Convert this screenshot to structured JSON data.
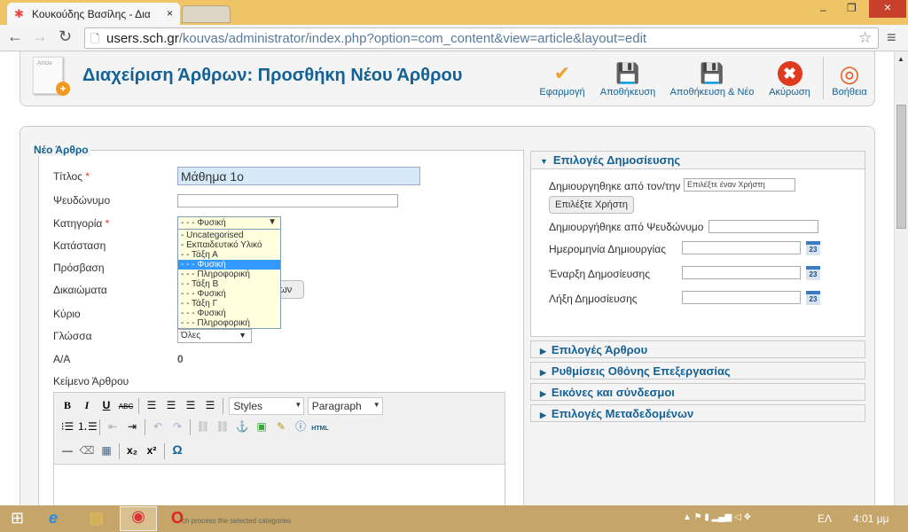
{
  "browser": {
    "tab_title": "Κουκούδης Βασίλης - Δια",
    "url_host": "users.sch.gr",
    "url_path": "/kouvas/administrator/index.php?option=com_content&view=article&layout=edit"
  },
  "header": {
    "title": "Διαχείριση Άρθρων: Προσθήκη Νέου Άρθρου",
    "icon_text": "Article",
    "buttons": [
      {
        "label": "Εφαρμογή",
        "icon": "check-icon",
        "color": "#f0a030"
      },
      {
        "label": "Αποθήκευση",
        "icon": "save-icon",
        "color": "#555"
      },
      {
        "label": "Αποθήκευση & Νέο",
        "icon": "save-new-icon",
        "color": "#555"
      },
      {
        "label": "Ακύρωση",
        "icon": "cancel-icon",
        "color": "#e03a1e"
      },
      {
        "label": "Βοήθεια",
        "icon": "lifebuoy-icon",
        "color": "#e85a20"
      }
    ]
  },
  "form": {
    "legend": "Νέο Άρθρο",
    "labels": {
      "title": "Τίτλος",
      "alias": "Ψευδώνυμο",
      "category": "Κατηγορία",
      "state": "Κατάσταση",
      "access": "Πρόσβαση",
      "permissions": "Δικαιώματα",
      "featured": "Κύριο",
      "language": "Γλώσσα",
      "id": "Α/Α",
      "text": "Κείμενο Άρθρου"
    },
    "required_mark": "*",
    "title_value": "Μάθημα 1ο",
    "alias_value": "",
    "category_value": "- - - Φυσική",
    "category_options": [
      "- Uncategorised",
      "- Εκπαιδευτικό Υλικό",
      "- - Τάξη Α",
      "- - - Φυσική",
      "- - - Πληροφορική",
      "- - Τάξη Β",
      "- - - Φυσική",
      "- - Τάξη Γ",
      "- - - Φυσική",
      "- - - Πληροφορική"
    ],
    "category_selected_index": 3,
    "permissions_button_visible": "των",
    "language_value": "Όλες",
    "id_value": "0"
  },
  "editor": {
    "styles": "Styles",
    "paragraph": "Paragraph",
    "html_label": "HTML"
  },
  "publishing": {
    "title": "Επιλογές Δημοσίευσης",
    "created_by": "Δημιουργηθηκε από τον/την",
    "created_by_value": "Επιλέξτε έναν Χρήστη",
    "select_user": "Επιλέξτε Χρήστη",
    "created_by_alias": "Δημιουργήθηκε από Ψευδώνυμο",
    "created": "Ημερομηνία Δημιουργίας",
    "publish_up": "Έναρξη Δημοσίευσης",
    "publish_down": "Λήξη Δημοσίευσης",
    "cal_day": "23"
  },
  "panels": [
    "Επιλογές Άρθρου",
    "Ρυθμίσεις Οθόνης Επεξεργασίας",
    "Εικόνες και σύνδεσμοι",
    "Επιλογές Μεταδεδομένων"
  ],
  "taskbar": {
    "notification": "ch process the selected categories",
    "lang": "ΕΛ",
    "time": "4:01 μμ"
  }
}
